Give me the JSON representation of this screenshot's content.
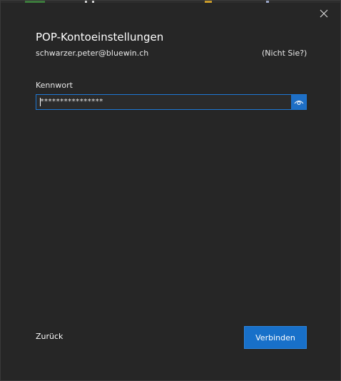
{
  "dialog": {
    "title": "POP-Kontoeinstellungen",
    "account_email": "schwarzer.peter@bluewin.ch",
    "not_you_link": "(Nicht Sie?)",
    "close_icon": "close-icon"
  },
  "password": {
    "label": "Kennwort",
    "value": "****************",
    "reveal_icon": "eye-icon"
  },
  "footer": {
    "back_label": "Zurück",
    "connect_label": "Verbinden"
  },
  "colors": {
    "background": "#262626",
    "accent": "#1870c9",
    "focus_border": "#1e78d4",
    "text": "#ffffff"
  }
}
